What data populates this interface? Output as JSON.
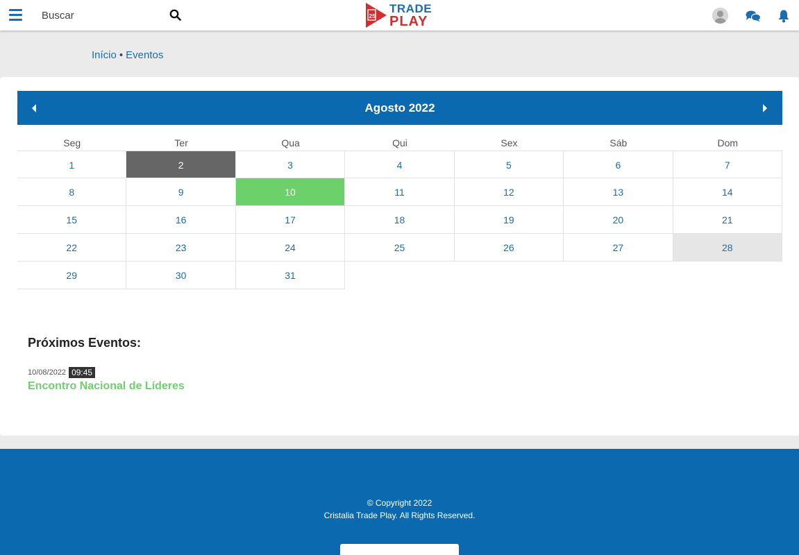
{
  "header": {
    "search_placeholder": "Buscar",
    "logo": {
      "line1": "TRADE",
      "line2": "PLAY"
    }
  },
  "breadcrumb": {
    "home": "Início",
    "separator": "•",
    "current": "Eventos"
  },
  "calendar": {
    "title": "Agosto 2022",
    "weekdays": [
      "Seg",
      "Ter",
      "Qua",
      "Qui",
      "Sex",
      "Sáb",
      "Dom"
    ],
    "days": [
      "1",
      "2",
      "3",
      "4",
      "5",
      "6",
      "7",
      "8",
      "9",
      "10",
      "11",
      "12",
      "13",
      "14",
      "15",
      "16",
      "17",
      "18",
      "19",
      "20",
      "21",
      "22",
      "23",
      "24",
      "25",
      "26",
      "27",
      "28",
      "29",
      "30",
      "31"
    ],
    "selected_day": "2",
    "event_day": "10",
    "highlighted_day": "28"
  },
  "events": {
    "title": "Próximos Eventos:",
    "items": [
      {
        "date": "10/08/2022",
        "time": "09:45",
        "name": "Encontro Nacional de Líderes"
      }
    ]
  },
  "footer": {
    "line1": "© Copyright 2022",
    "line2": "Cristalia Trade Play. All Rights Reserved."
  },
  "colors": {
    "primary": "#0b6aaf",
    "event": "#6dd16b",
    "selected": "#666666",
    "highlight": "#e6e6e6"
  }
}
